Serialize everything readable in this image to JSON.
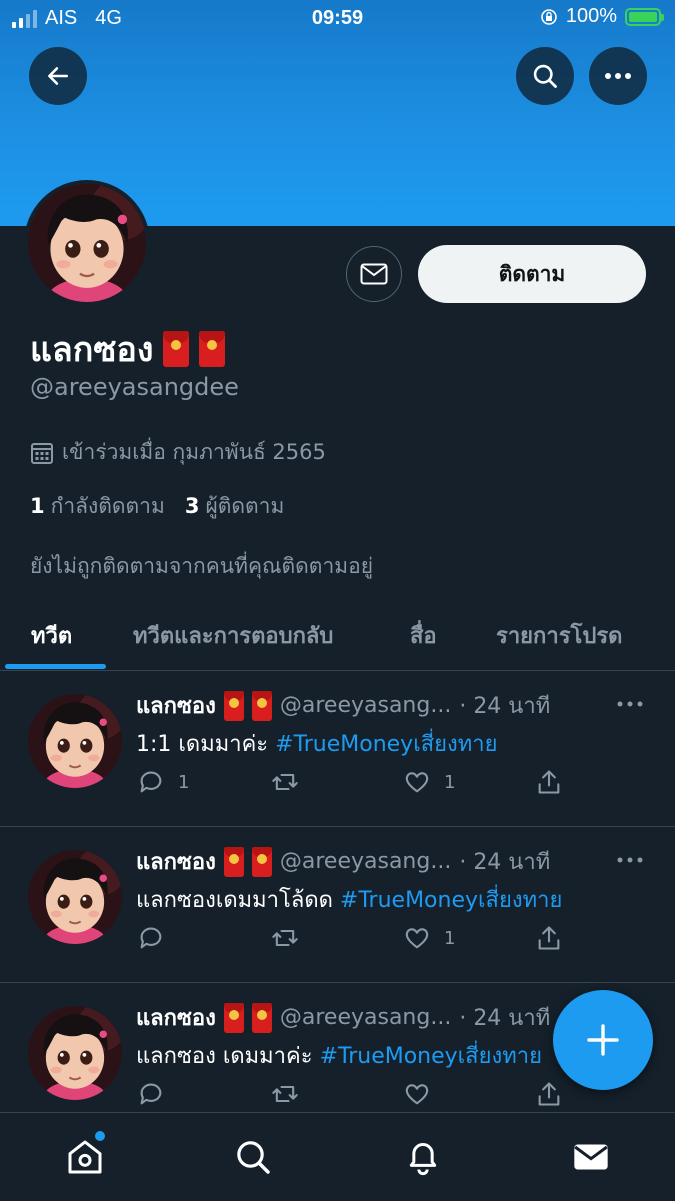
{
  "status_bar": {
    "carrier": "AIS",
    "network": "4G",
    "time": "09:59",
    "battery": "100%"
  },
  "profile": {
    "name": "แลกซอง",
    "handle": "@areeyasangdee",
    "joined": "เข้าร่วมเมื่อ กุมภาพันธ์ 2565",
    "following_count": "1",
    "following_label": "กำลังติดตาม",
    "followers_count": "3",
    "followers_label": "ผู้ติดตาม",
    "not_followed_note": "ยังไม่ถูกติดตามจากคนที่คุณติดตามอยู่",
    "follow_button": "ติดตาม"
  },
  "tabs": [
    {
      "label": "ทวีต",
      "active": true
    },
    {
      "label": "ทวีตและการตอบกลับ",
      "active": false
    },
    {
      "label": "สื่อ",
      "active": false
    },
    {
      "label": "รายการโปรด",
      "active": false
    }
  ],
  "tweets": [
    {
      "name": "แลกซอง",
      "handle": "@areeyasang...",
      "time": "· 24 นาที",
      "text": "1:1 เดมมาค่ะ ",
      "hashtag": "#TrueMoneyเสี่ยงทาย",
      "replies": "1",
      "likes": "1"
    },
    {
      "name": "แลกซอง",
      "handle": "@areeyasang...",
      "time": "· 24 นาที",
      "text": "แลกซองเดมมาโล้ดด ",
      "hashtag": "#TrueMoneyเสี่ยงทาย",
      "replies": "",
      "likes": "1"
    },
    {
      "name": "แลกซอง",
      "handle": "@areeyasang...",
      "time": "· 24 นาที",
      "text": "แลกซอง เดมมาค่ะ ",
      "hashtag": "#TrueMoneyเสี่ยงทาย",
      "replies": "",
      "likes": ""
    }
  ],
  "icons": {
    "back": "arrow-left-icon",
    "search": "search-icon",
    "more": "ellipsis-icon",
    "message": "envelope-icon",
    "calendar": "calendar-icon",
    "compose": "plus-icon",
    "nav": [
      "home-icon",
      "search-icon",
      "bell-icon",
      "mail-icon"
    ]
  },
  "colors": {
    "accent": "#1d9bf0",
    "background": "#15202b",
    "muted": "#8b98a5",
    "banner": "#1d9bf0"
  }
}
